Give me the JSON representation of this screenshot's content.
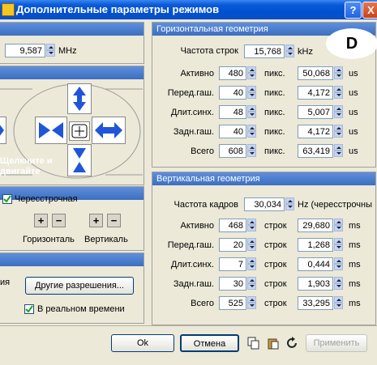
{
  "window": {
    "title": "Дополнительные параметры режимов",
    "help_glyph": "?",
    "close_glyph": "X"
  },
  "left": {
    "freq_value": "9,587",
    "freq_unit": "MHz",
    "hint_line1": "Щелкните и",
    "hint_line2": "двигайте",
    "interlace_label": "Чересстрочная",
    "interlace_checked": true,
    "plus": "+",
    "minus": "−",
    "horizontal_label": "Горизонталь",
    "vertical_label": "Вертикаль",
    "partial_label": "ия",
    "other_res_label": "Другие разрешения...",
    "realtime_label": "В реальном времени",
    "realtime_checked": true
  },
  "hgeo": {
    "header": "Горизонтальная геометрия",
    "freq_label": "Частота строк",
    "freq_value": "15,768",
    "freq_unit": "kHz",
    "rows": [
      {
        "label": "Активно",
        "value": "480",
        "unit": "пикс.",
        "us": "50,068",
        "us_unit": "us"
      },
      {
        "label": "Перед.гаш.",
        "value": "40",
        "unit": "пикс.",
        "us": "4,172",
        "us_unit": "us"
      },
      {
        "label": "Длит.синх.",
        "value": "48",
        "unit": "пикс.",
        "us": "5,007",
        "us_unit": "us"
      },
      {
        "label": "Задн.гаш.",
        "value": "40",
        "unit": "пикс.",
        "us": "4,172",
        "us_unit": "us"
      },
      {
        "label": "Всего",
        "value": "608",
        "unit": "пикс.",
        "us": "63,419",
        "us_unit": "us"
      }
    ]
  },
  "vgeo": {
    "header": "Вертикальная геометрия",
    "freq_label": "Частота кадров",
    "freq_value": "30,034",
    "freq_unit": "Hz (чересстрочны",
    "rows": [
      {
        "label": "Активно",
        "value": "468",
        "unit": "строк",
        "ms": "29,680",
        "ms_unit": "ms"
      },
      {
        "label": "Перед.гаш.",
        "value": "20",
        "unit": "строк",
        "ms": "1,268",
        "ms_unit": "ms"
      },
      {
        "label": "Длит.синх.",
        "value": "7",
        "unit": "строк",
        "ms": "0,444",
        "ms_unit": "ms"
      },
      {
        "label": "Задн.гаш.",
        "value": "30",
        "unit": "строк",
        "ms": "1,903",
        "ms_unit": "ms"
      },
      {
        "label": "Всего",
        "value": "525",
        "unit": "строк",
        "ms": "33,295",
        "ms_unit": "ms"
      }
    ]
  },
  "badge": "D",
  "buttons": {
    "ok": "Ok",
    "cancel": "Отмена",
    "apply": "Применить"
  },
  "icons": {
    "copy": "copy-icon",
    "paste": "paste-icon",
    "reset": "reset-icon",
    "move": "move-icon"
  },
  "colors": {
    "title_bar": "#0a5ad8",
    "section_header": "#4a7cce",
    "dialog_bg": "#ece9d8",
    "arrow_blue": "#1f56d8",
    "badge_bg": "#ffffff"
  }
}
